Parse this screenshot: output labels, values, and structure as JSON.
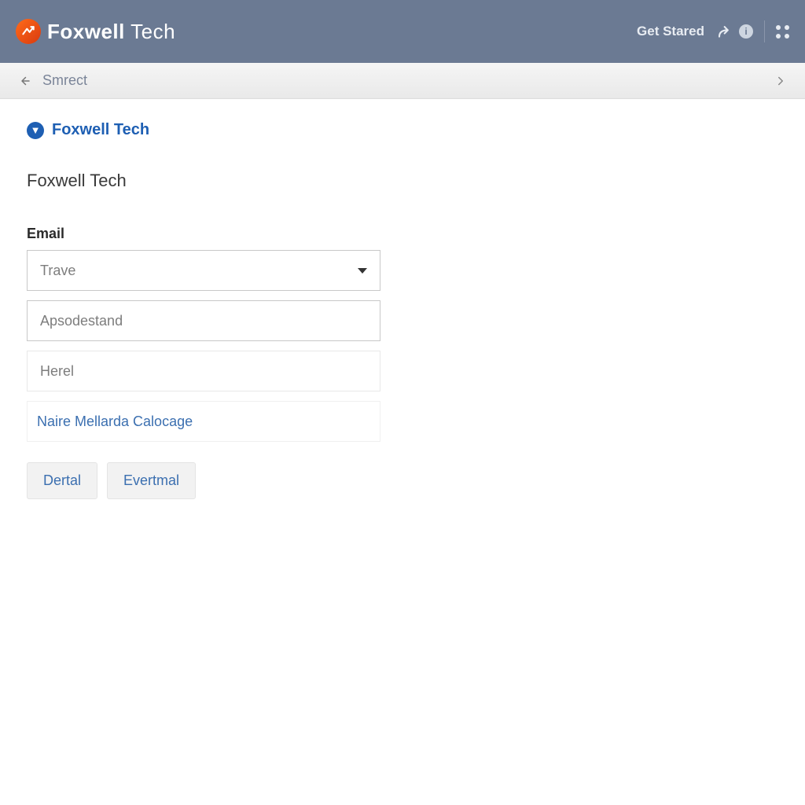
{
  "header": {
    "brand_bold": "Foxwell",
    "brand_light": "Tech",
    "get_started": "Get Stared"
  },
  "subbar": {
    "crumb": "Smrect"
  },
  "info": {
    "title": "Foxwell Tech"
  },
  "page": {
    "heading": "Foxwell Tech"
  },
  "form": {
    "email_label": "Email",
    "select_value": "Trave",
    "field2": "Apsodestand",
    "field3": "Herel",
    "link_text": "Naire Mellarda Calocage"
  },
  "buttons": {
    "btn1": "Dertal",
    "btn2": "Evertmal"
  }
}
